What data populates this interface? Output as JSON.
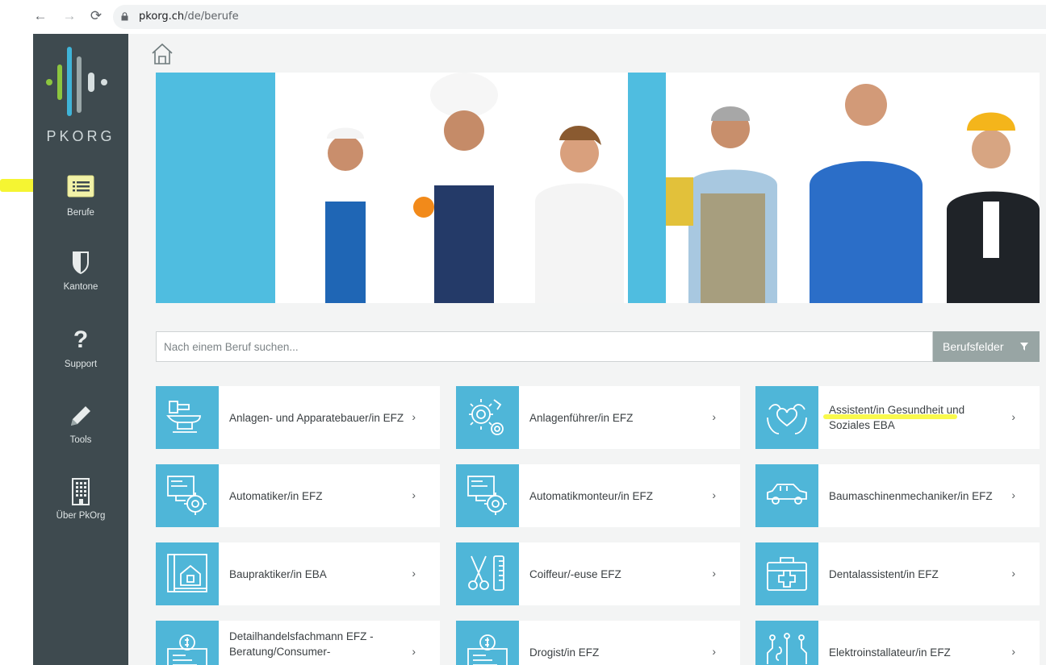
{
  "browser": {
    "url_domain": "pkorg.ch",
    "url_path": "/de/berufe"
  },
  "sidebar": {
    "logo_text": "PKORG",
    "items": [
      {
        "label": "Berufe",
        "icon": "list-icon"
      },
      {
        "label": "Kantone",
        "icon": "shield-icon"
      },
      {
        "label": "Support",
        "icon": "question-icon"
      },
      {
        "label": "Tools",
        "icon": "pencil-icon"
      },
      {
        "label": "Über PkOrg",
        "icon": "building-icon"
      }
    ]
  },
  "search": {
    "placeholder": "Nach einem Beruf suchen...",
    "filter_label": "Berufsfelder"
  },
  "cards": [
    {
      "title": "Anlagen- und Apparatebauer/in EFZ",
      "icon": "anvil-icon"
    },
    {
      "title": "Anlagenführer/in EFZ",
      "icon": "gears-icon"
    },
    {
      "title": "Assistent/in Gesundheit und Soziales EBA",
      "icon": "caring-hands-icon"
    },
    {
      "title": "Automatiker/in EFZ",
      "icon": "computer-gear-icon"
    },
    {
      "title": "Automatikmonteur/in EFZ",
      "icon": "computer-gear-icon"
    },
    {
      "title": "Baumaschinenmechaniker/in EFZ",
      "icon": "car-icon"
    },
    {
      "title": "Baupraktiker/in EBA",
      "icon": "house-plan-icon"
    },
    {
      "title": "Coiffeur/-euse EFZ",
      "icon": "scissors-comb-icon"
    },
    {
      "title": "Dentalassistent/in EFZ",
      "icon": "first-aid-kit-icon"
    },
    {
      "title": "Detailhandelsfachmann EFZ - Beratung/Consumer-",
      "icon": "invoice-icon"
    },
    {
      "title": "Drogist/in EFZ",
      "icon": "invoice-icon"
    },
    {
      "title": "Elektroinstallateur/in EFZ",
      "icon": "circuit-icon"
    }
  ],
  "chevron": "›"
}
